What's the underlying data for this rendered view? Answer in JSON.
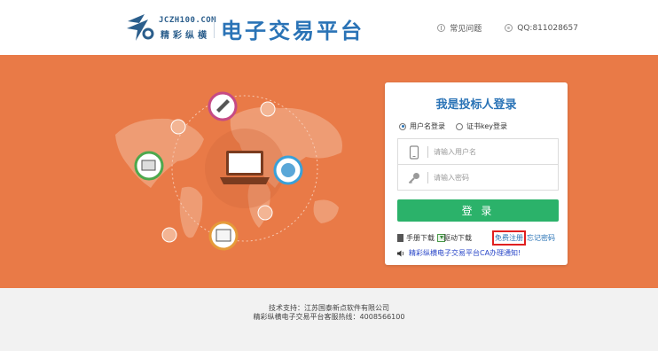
{
  "header": {
    "logo_en": "JCZH100.COM",
    "logo_cn": "精彩纵横",
    "title": "电子交易平台",
    "help_label": "常见问题",
    "qq_label": "QQ:811028657"
  },
  "login": {
    "title": "我是投标人登录",
    "mode_username": "用户名登录",
    "mode_key": "证书key登录",
    "username_placeholder": "请输入用户名",
    "password_placeholder": "请输入密码",
    "login_button": "登 录",
    "manual_download": "手册下载",
    "driver_download": "驱动下载",
    "register": "免费注册",
    "forgot_password": "忘记密码",
    "notice": "精彩纵横电子交易平台CA办理通知!"
  },
  "footer": {
    "support": "技术支持：江苏国泰新点软件有限公司",
    "hotline": "精彩纵横电子交易平台客服热线：4008566100"
  },
  "colors": {
    "banner": "#e97a47",
    "brand_blue": "#2a73b6",
    "login_green": "#2bb26a",
    "register_outline": "#e02020"
  },
  "icons": [
    "logo-mark",
    "help-icon",
    "qq-icon",
    "laptop-icon",
    "phone-icon",
    "key-icon",
    "book-icon",
    "download-icon",
    "speaker-icon"
  ]
}
